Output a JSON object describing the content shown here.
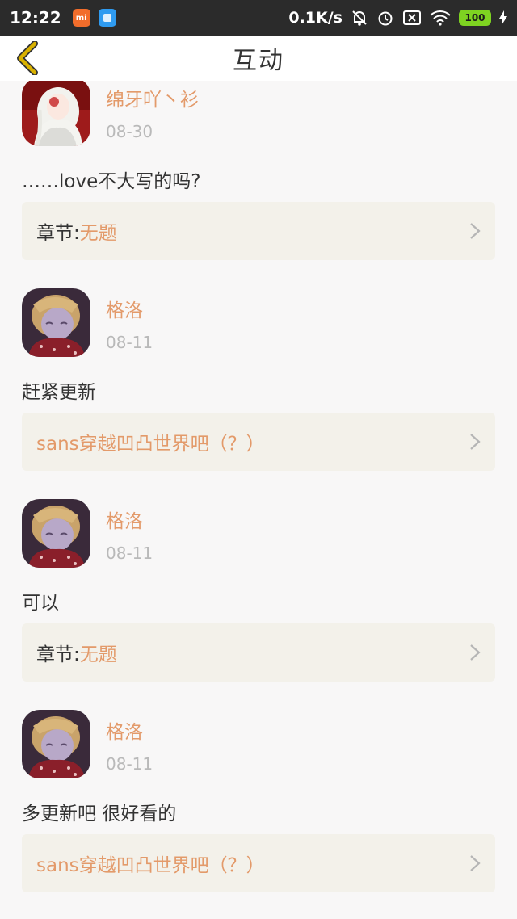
{
  "status_bar": {
    "time": "12:22",
    "mi_badge": "mi",
    "net_speed": "0.1K/s",
    "battery": "100"
  },
  "header": {
    "title": "互动"
  },
  "comments": [
    {
      "username": "绵牙吖丶衫",
      "date": "08-30",
      "text": "……love不大写的吗?",
      "chapter_label": "章节:",
      "chapter_title": "无题"
    },
    {
      "username": "格洛",
      "date": "08-11",
      "text": "赶紧更新",
      "chapter_label": "",
      "chapter_title": "sans穿越凹凸世界吧（？）"
    },
    {
      "username": "格洛",
      "date": "08-11",
      "text": "可以",
      "chapter_label": "章节:",
      "chapter_title": "无题"
    },
    {
      "username": "格洛",
      "date": "08-11",
      "text": "多更新吧 很好看的",
      "chapter_label": "",
      "chapter_title": "sans穿越凹凸世界吧（？）"
    }
  ],
  "colors": {
    "accent": "#e39a6a",
    "back_arrow": "#d9b100",
    "card_bg": "#f3f1ea"
  },
  "icons": {
    "back": "back-arrow-icon",
    "chevron": "chevron-right-icon",
    "avatar_1": "avatar-white-hair-girl",
    "avatar_2": "avatar-blond-boy-red-scarf"
  }
}
